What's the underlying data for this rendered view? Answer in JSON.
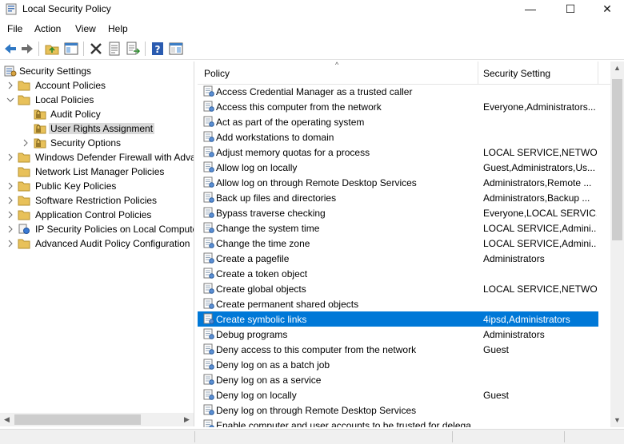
{
  "window": {
    "title": "Local Security Policy",
    "minimize_glyph": "—",
    "maximize_glyph": "☐",
    "close_glyph": "✕"
  },
  "menu": {
    "items": [
      "File",
      "Action",
      "View",
      "Help"
    ]
  },
  "toolbar": {
    "buttons": [
      "back-icon",
      "forward-icon",
      "up-folder-icon",
      "show-hide-tree-icon",
      "delete-icon",
      "properties-icon",
      "export-list-icon",
      "help-icon",
      "show-pane-icon"
    ]
  },
  "tree": {
    "root": "Security Settings",
    "items": [
      {
        "label": "Account Policies"
      },
      {
        "label": "Local Policies"
      },
      {
        "label": "Audit Policy"
      },
      {
        "label": "User Rights Assignment"
      },
      {
        "label": "Security Options"
      },
      {
        "label": "Windows Defender Firewall with Adva"
      },
      {
        "label": "Network List Manager Policies"
      },
      {
        "label": "Public Key Policies"
      },
      {
        "label": "Software Restriction Policies"
      },
      {
        "label": "Application Control Policies"
      },
      {
        "label": "IP Security Policies on Local Compute"
      },
      {
        "label": "Advanced Audit Policy Configuration"
      }
    ],
    "scroll_left_glyph": "◀",
    "scroll_right_glyph": "▶"
  },
  "list": {
    "columns": {
      "policy": "Policy",
      "setting": "Security Setting",
      "sort_glyph": "^"
    },
    "rows": [
      {
        "policy": "Access Credential Manager as a trusted caller",
        "setting": ""
      },
      {
        "policy": "Access this computer from the network",
        "setting": "Everyone,Administrators..."
      },
      {
        "policy": "Act as part of the operating system",
        "setting": ""
      },
      {
        "policy": "Add workstations to domain",
        "setting": ""
      },
      {
        "policy": "Adjust memory quotas for a process",
        "setting": "LOCAL SERVICE,NETWO..."
      },
      {
        "policy": "Allow log on locally",
        "setting": "Guest,Administrators,Us..."
      },
      {
        "policy": "Allow log on through Remote Desktop Services",
        "setting": "Administrators,Remote ..."
      },
      {
        "policy": "Back up files and directories",
        "setting": "Administrators,Backup ..."
      },
      {
        "policy": "Bypass traverse checking",
        "setting": "Everyone,LOCAL SERVIC..."
      },
      {
        "policy": "Change the system time",
        "setting": "LOCAL SERVICE,Admini..."
      },
      {
        "policy": "Change the time zone",
        "setting": "LOCAL SERVICE,Admini..."
      },
      {
        "policy": "Create a pagefile",
        "setting": "Administrators"
      },
      {
        "policy": "Create a token object",
        "setting": ""
      },
      {
        "policy": "Create global objects",
        "setting": "LOCAL SERVICE,NETWO..."
      },
      {
        "policy": "Create permanent shared objects",
        "setting": ""
      },
      {
        "policy": "Create symbolic links",
        "setting": "4ipsd,Administrators"
      },
      {
        "policy": "Debug programs",
        "setting": "Administrators"
      },
      {
        "policy": "Deny access to this computer from the network",
        "setting": "Guest"
      },
      {
        "policy": "Deny log on as a batch job",
        "setting": ""
      },
      {
        "policy": "Deny log on as a service",
        "setting": ""
      },
      {
        "policy": "Deny log on locally",
        "setting": "Guest"
      },
      {
        "policy": "Deny log on through Remote Desktop Services",
        "setting": ""
      },
      {
        "policy": "Enable computer and user accounts to be trusted for delega...",
        "setting": ""
      }
    ],
    "selected_index": 15,
    "scroll_up_glyph": "▲",
    "scroll_down_glyph": "▼"
  },
  "colors": {
    "selection": "#0078d7",
    "tree_selection": "#d9d9d9",
    "folder": "#e8c15a"
  }
}
